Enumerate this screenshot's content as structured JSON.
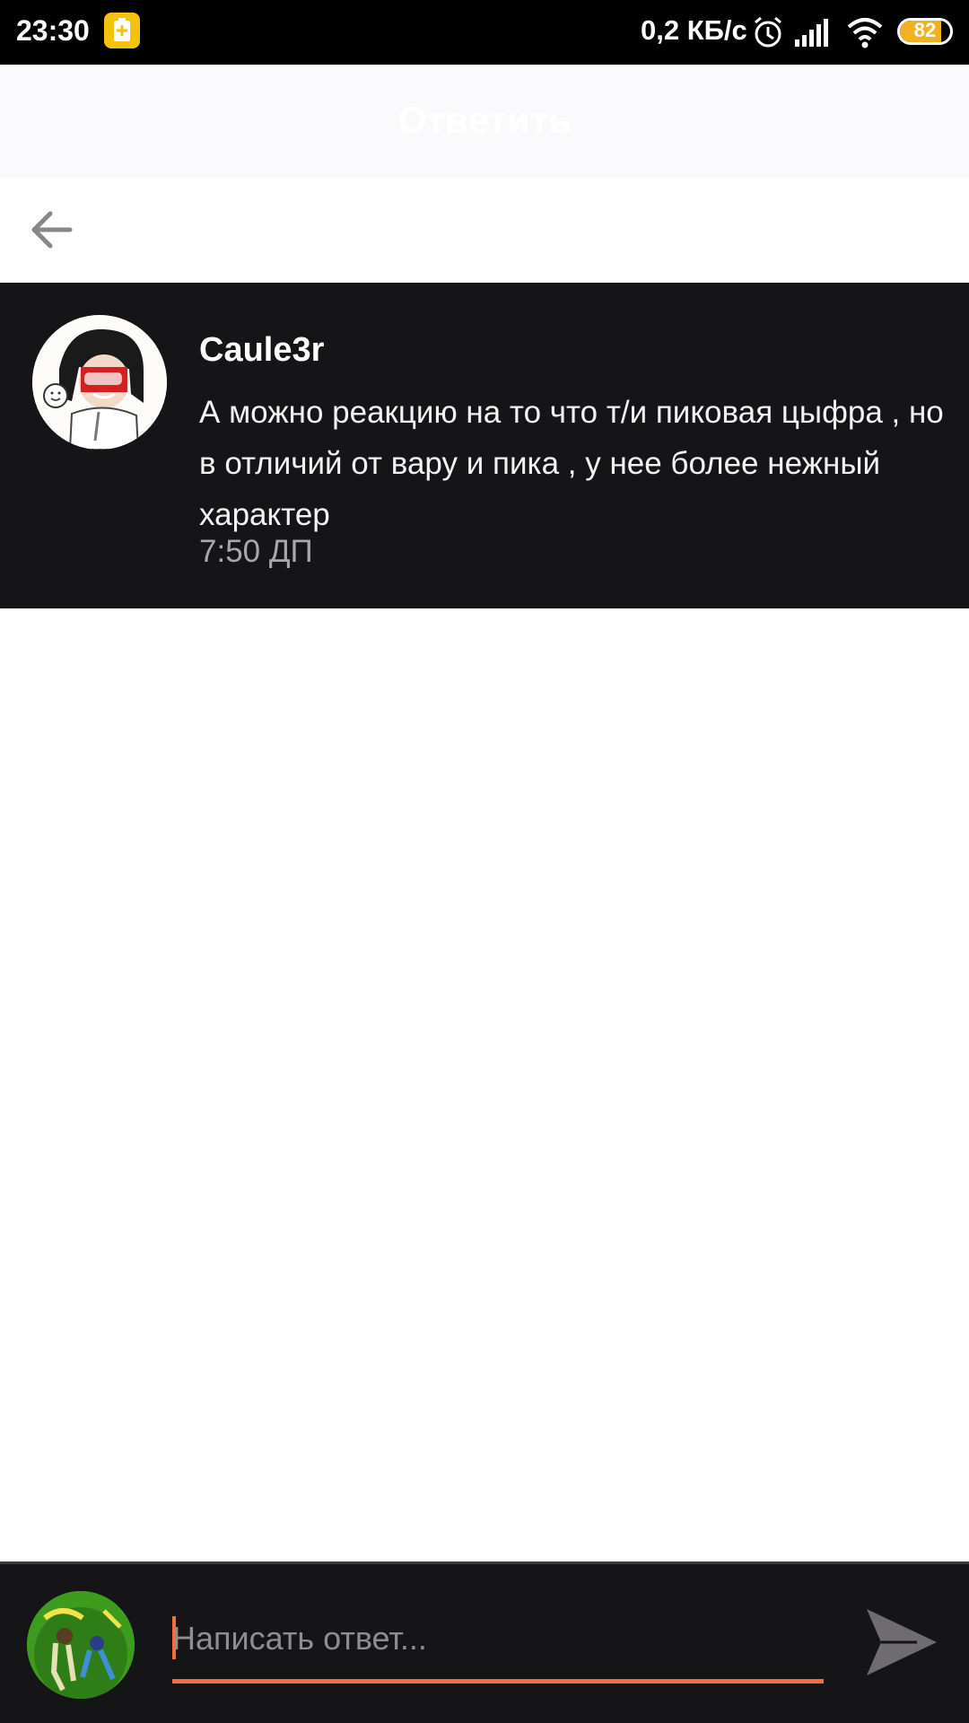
{
  "status_bar": {
    "time": "23:30",
    "net_speed": "0,2 КБ/с",
    "battery_level": "82",
    "battery_fraction": 0.82,
    "battery_color": "#f0b21f",
    "icons": [
      "app-notification-icon",
      "alarm-icon",
      "signal-icon",
      "wifi-icon",
      "battery-icon"
    ]
  },
  "header": {
    "title": "Ответить"
  },
  "nav": {
    "back_icon": "arrow-left-icon"
  },
  "message": {
    "author": "Caule3r",
    "text": "А можно реакцию на то что т/и пиковая цыфра , но в отличий от вару и пика , у нее более нежный характер",
    "time": "7:50 ДП"
  },
  "reply": {
    "placeholder": "Написать ответ...",
    "value": "",
    "send_icon": "send-icon",
    "accent_color": "#f26f3c"
  },
  "colors": {
    "dark_bg": "#151416",
    "accent": "#f26f3c"
  }
}
